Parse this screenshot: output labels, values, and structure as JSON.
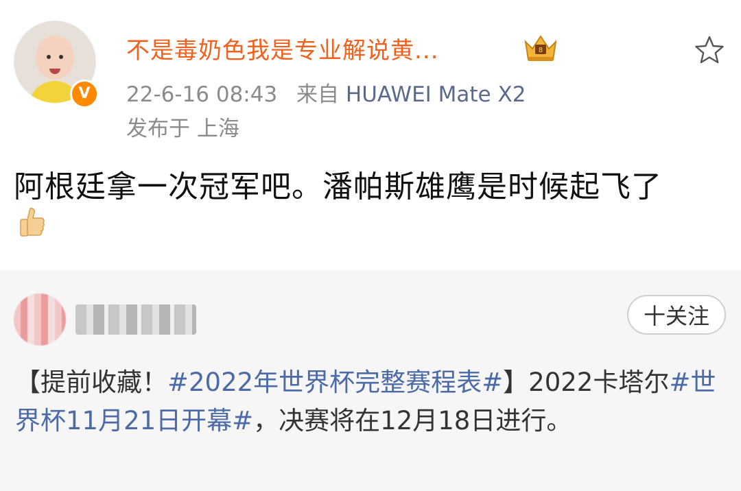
{
  "post": {
    "username": "不是毒奶色我是专业解说黄...",
    "timestamp": "22-6-16 08:43",
    "source_prefix": "来自",
    "device": "HUAWEI Mate X2",
    "location": "发布于 上海",
    "content": "阿根廷拿一次冠军吧。潘帕斯雄鹰是时候起飞了",
    "verified_badge": "V",
    "icons": {
      "crown": "crown-icon",
      "star": "star-icon",
      "thumb": "thumbs-up-icon"
    },
    "colors": {
      "username": "#f2601d",
      "badge": "#ff8a00"
    }
  },
  "repost": {
    "follow_label": "十关注",
    "text": {
      "p1": "【提前收藏！",
      "tag1": "#2022年世界杯完整赛程表#",
      "p2": "】2022卡塔尔",
      "tag2": "#世界杯11月21日开幕#",
      "p3": "，决赛将在12月18日进行。"
    },
    "colors": {
      "tag": "#4b6aa6",
      "background": "#f6f6f6"
    }
  }
}
